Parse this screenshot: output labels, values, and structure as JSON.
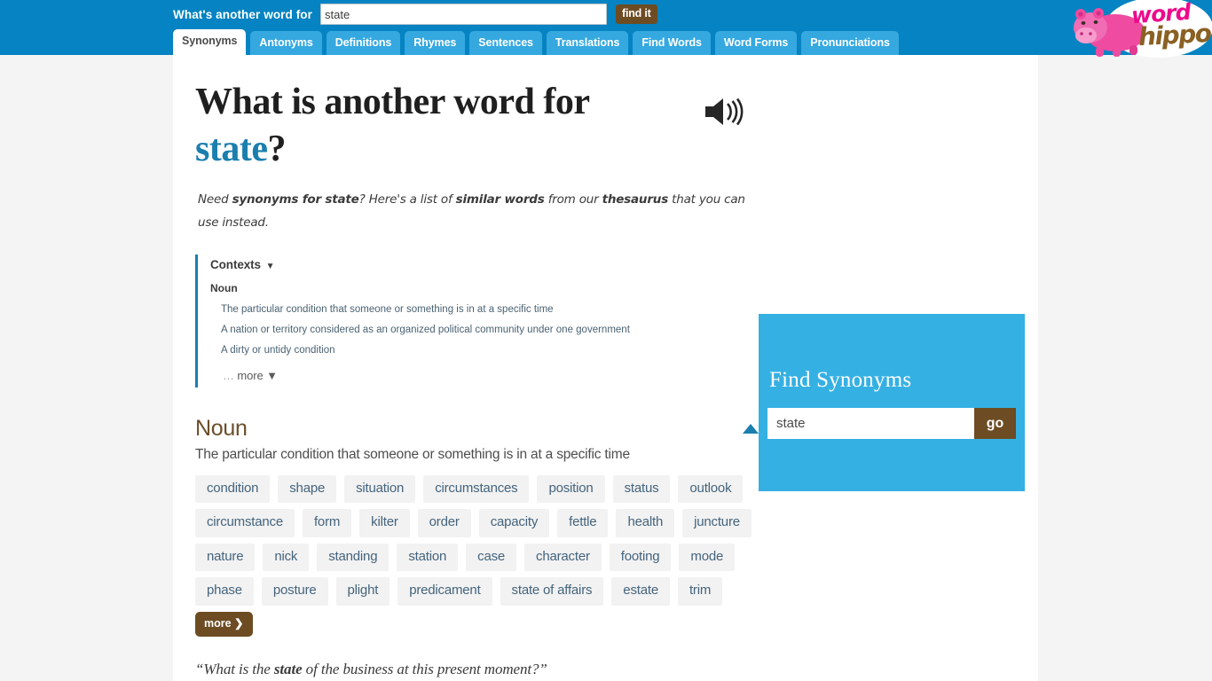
{
  "header": {
    "search_label": "What's another word for",
    "search_value": "state",
    "search_placeholder": "",
    "find_button": "find it",
    "tabs": [
      {
        "label": "Synonyms",
        "active": true
      },
      {
        "label": "Antonyms",
        "active": false
      },
      {
        "label": "Definitions",
        "active": false
      },
      {
        "label": "Rhymes",
        "active": false
      },
      {
        "label": "Sentences",
        "active": false
      },
      {
        "label": "Translations",
        "active": false
      },
      {
        "label": "Find Words",
        "active": false
      },
      {
        "label": "Word Forms",
        "active": false
      },
      {
        "label": "Pronunciations",
        "active": false
      }
    ],
    "logo": {
      "word": "word",
      "hippo": "hippo"
    },
    "theme_icon": "sun-icon",
    "colors": {
      "bar": "#0583c2",
      "tab": "#35a8e0",
      "brown": "#6d4c23"
    }
  },
  "main": {
    "title_prefix": "What is another word for",
    "title_word": "state",
    "title_suffix": "?",
    "speaker_icon": "speaker-icon",
    "lead": {
      "p1": "Need ",
      "b1": "synonyms for state",
      "p2": "? Here's a list of ",
      "b2": "similar words",
      "p3": " from our ",
      "b3": "thesaurus",
      "p4": " that you can use instead."
    },
    "contexts": {
      "heading": "Contexts",
      "caret": "▼",
      "pos": "Noun",
      "items": [
        "The particular condition that someone or something is in at a specific time",
        "A nation or territory considered as an organized political community under one government",
        "A dirty or untidy condition"
      ],
      "more_dots": "…",
      "more_label": " more ",
      "more_caret": "▼"
    },
    "section": {
      "title": "Noun",
      "definition": "The particular condition that someone or something is in at a specific time",
      "words": [
        "condition",
        "shape",
        "situation",
        "circumstances",
        "position",
        "status",
        "outlook",
        "circumstance",
        "form",
        "kilter",
        "order",
        "capacity",
        "fettle",
        "health",
        "juncture",
        "nature",
        "nick",
        "standing",
        "station",
        "case",
        "character",
        "footing",
        "mode",
        "phase",
        "posture",
        "plight",
        "predicament",
        "state of affairs",
        "estate",
        "trim"
      ],
      "more_label": "more ❯"
    },
    "quote": {
      "open": "“What is the ",
      "bold": "state",
      "close": " of the business at this present moment?”"
    }
  },
  "sidebar": {
    "title": "Find Synonyms",
    "input_value": "state",
    "input_placeholder": "",
    "go_label": "go",
    "background": "#35b0e3"
  }
}
